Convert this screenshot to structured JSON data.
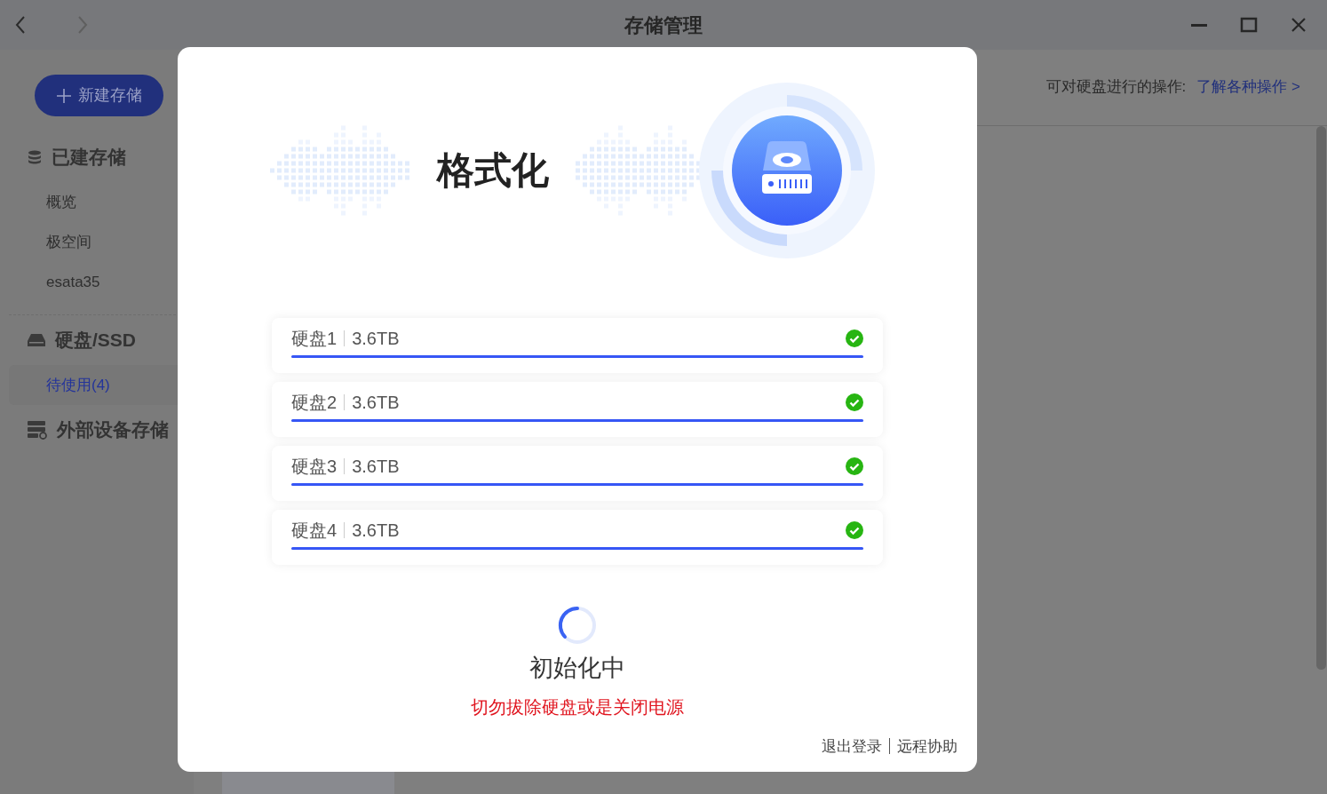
{
  "window": {
    "title": "存储管理"
  },
  "sidebar": {
    "new_button": "新建存储",
    "sections": [
      {
        "kind": "storage",
        "title": "已建存储",
        "items": [
          {
            "label": "概览",
            "selected": false
          },
          {
            "label": "极空间",
            "selected": false
          },
          {
            "label": "esata35",
            "selected": false
          }
        ]
      },
      {
        "kind": "disk",
        "title": "硬盘/SSD",
        "items": [
          {
            "label": "待使用(4)",
            "selected": true
          }
        ]
      },
      {
        "kind": "external",
        "title": "外部设备存储"
      }
    ]
  },
  "header": {
    "text": "可对硬盘进行的操作:",
    "link": "了解各种操作 >"
  },
  "dialog": {
    "title": "格式化",
    "disks": [
      {
        "name": "硬盘1",
        "size": "3.6TB",
        "level": 1,
        "done": true
      },
      {
        "name": "硬盘2",
        "size": "3.6TB",
        "level": 1,
        "done": true
      },
      {
        "name": "硬盘3",
        "size": "3.6TB",
        "level": 1,
        "done": true
      },
      {
        "name": "硬盘4",
        "size": "3.6TB",
        "level": 1,
        "done": true
      }
    ],
    "status": "初始化中",
    "warning": "切勿拔除硬盘或是关闭电源",
    "footer_links": [
      "退出登录",
      "远程协助"
    ]
  }
}
